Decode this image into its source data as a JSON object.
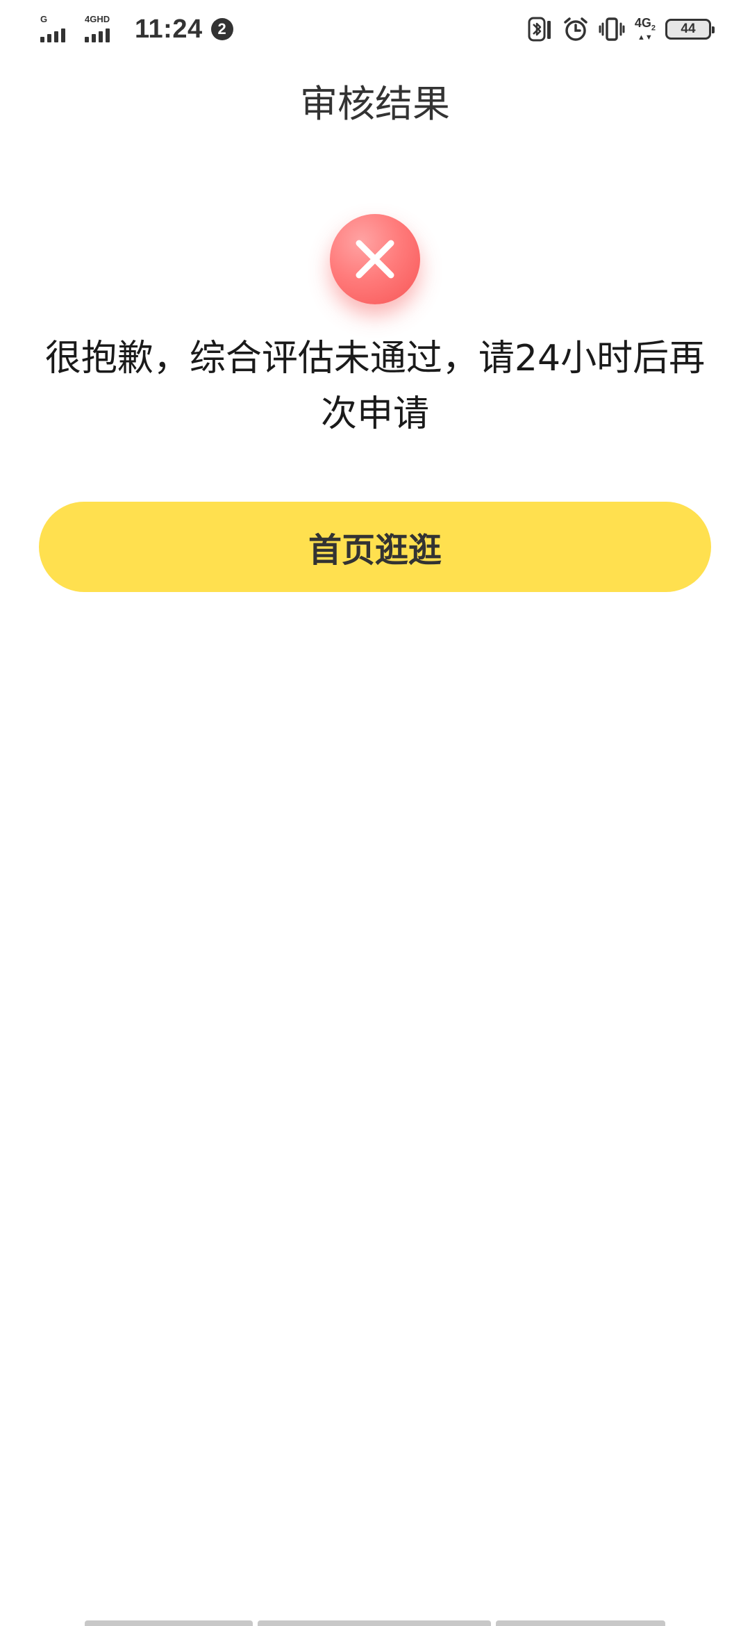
{
  "status_bar": {
    "network_1": "G",
    "network_2": "4GHD",
    "time": "11:24",
    "notification_count": "2",
    "network_3": "4G",
    "network_3_sub": "2",
    "battery": "44"
  },
  "header": {
    "title": "审核结果"
  },
  "result": {
    "icon": "close-icon",
    "message": "很抱歉，综合评估未通过，请24小时后再次申请"
  },
  "actions": {
    "home_label": "首页逛逛"
  },
  "colors": {
    "accent": "#ffe04f",
    "error": "#f75555",
    "text": "#333333"
  }
}
